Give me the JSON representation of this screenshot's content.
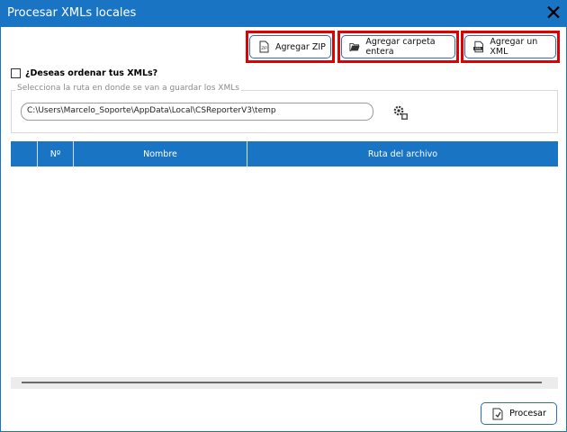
{
  "window": {
    "title": "Procesar XMLs locales",
    "close_glyph": "✕"
  },
  "toolbar": {
    "add_zip": "Agregar ZIP",
    "add_folder": "Agregar carpeta entera",
    "add_xml": "Agregar un XML",
    "zip_icon_text": "ZIP",
    "xml_icon_text": "XML"
  },
  "options": {
    "sort_label": "¿Deseas ordenar tus XMLs?",
    "sort_checked": false
  },
  "save_path": {
    "legend": "Selecciona la ruta en donde se van a guardar los XMLs",
    "value": "C:\\Users\\Marcelo_Soporte\\AppData\\Local\\CSReporterV3\\temp"
  },
  "table": {
    "columns": [
      "",
      "Nº",
      "Nombre",
      "Ruta del archivo"
    ],
    "rows": []
  },
  "footer": {
    "process_label": "Procesar"
  },
  "colors": {
    "accent": "#1a74c4",
    "highlight": "#e00000"
  }
}
